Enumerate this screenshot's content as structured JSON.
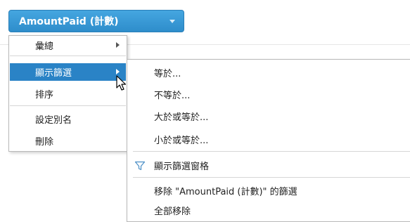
{
  "field_button": {
    "label": "AmountPaid (計數)"
  },
  "context_menu": {
    "items": [
      {
        "label": "彙總",
        "has_submenu": true
      },
      {
        "label": "顯示篩選",
        "has_submenu": true,
        "active": true
      },
      {
        "label": "排序",
        "has_submenu": false
      },
      {
        "label": "設定別名",
        "has_submenu": false
      },
      {
        "label": "刪除",
        "has_submenu": false
      }
    ]
  },
  "filter_submenu": {
    "items": [
      {
        "label": "等於..."
      },
      {
        "label": "不等於..."
      },
      {
        "label": "大於或等於..."
      },
      {
        "label": "小於或等於..."
      },
      {
        "label": "顯示篩選窗格",
        "icon": "funnel-icon"
      },
      {
        "label": "移除 \"AmountPaid (計數)\" 的篩選"
      },
      {
        "label": "全部移除"
      }
    ]
  },
  "colors": {
    "accent": "#2a83c6",
    "button_top": "#45a6e0",
    "button_bottom": "#2e8dcb"
  }
}
